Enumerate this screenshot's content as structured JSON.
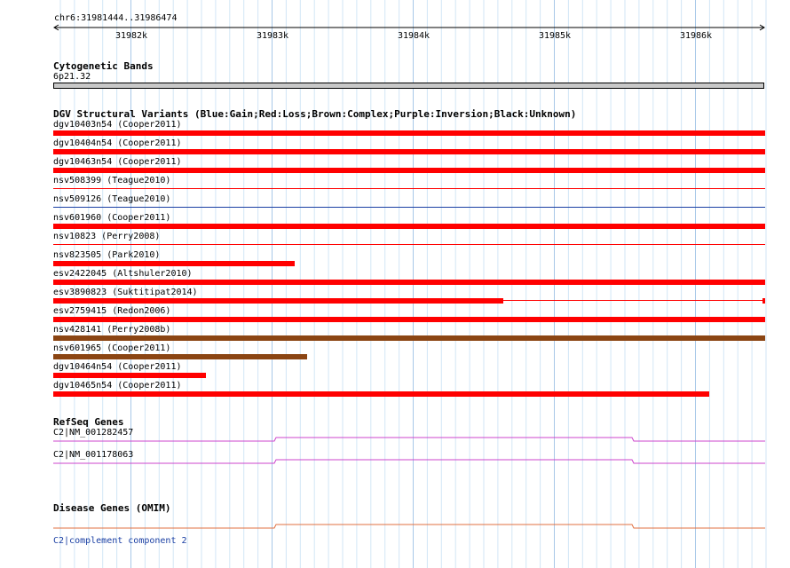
{
  "ruler": {
    "coords": "chr6:31981444..31986474",
    "ticks": [
      "31982k",
      "31983k",
      "31984k",
      "31985k",
      "31986k"
    ]
  },
  "cytoband": {
    "title": "Cytogenetic Bands",
    "band": "6p21.32"
  },
  "dgv": {
    "title": "DGV Structural Variants (Blue:Gain;Red:Loss;Brown:Complex;Purple:Inversion;Black:Unknown)",
    "variants": [
      {
        "label": "dgv10403n54 (Cooper2011)",
        "color": "#ff0000"
      },
      {
        "label": "dgv10404n54 (Cooper2011)",
        "color": "#ff0000"
      },
      {
        "label": "dgv10463n54 (Cooper2011)",
        "color": "#ff0000"
      },
      {
        "label": "nsv508399 (Teague2010)",
        "color": "#ff0000"
      },
      {
        "label": "nsv509126 (Teague2010)",
        "color": "#1a3fa3"
      },
      {
        "label": "nsv601960 (Cooper2011)",
        "color": "#ff0000"
      },
      {
        "label": "nsv10823 (Perry2008)",
        "color": "#ff0000"
      },
      {
        "label": "nsv823505 (Park2010)",
        "color": "#ff0000"
      },
      {
        "label": "esv2422045 (Altshuler2010)",
        "color": "#ff0000"
      },
      {
        "label": "esv3890823 (Suktitipat2014)",
        "color": "#ff0000"
      },
      {
        "label": "esv2759415 (Redon2006)",
        "color": "#8b4513"
      },
      {
        "label": "nsv428141 (Perry2008b)",
        "color": "#8b4513"
      },
      {
        "label": "nsv601965 (Cooper2011)",
        "color": "#ff0000"
      },
      {
        "label": "dgv10464n54 (Cooper2011)",
        "color": "#ff0000"
      },
      {
        "label": "dgv10465n54 (Cooper2011)",
        "color": "#ff0000"
      }
    ]
  },
  "refseq": {
    "title": "RefSeq Genes",
    "genes": [
      {
        "label": "C2|NM_001282457",
        "color": "#cc44cc"
      },
      {
        "label": "C2|NM_001178063",
        "color": "#cc44cc"
      }
    ]
  },
  "omim": {
    "title": "Disease Genes (OMIM)",
    "genes": [
      {
        "label": "C2|complement component 2",
        "color": "#e07040"
      }
    ]
  }
}
